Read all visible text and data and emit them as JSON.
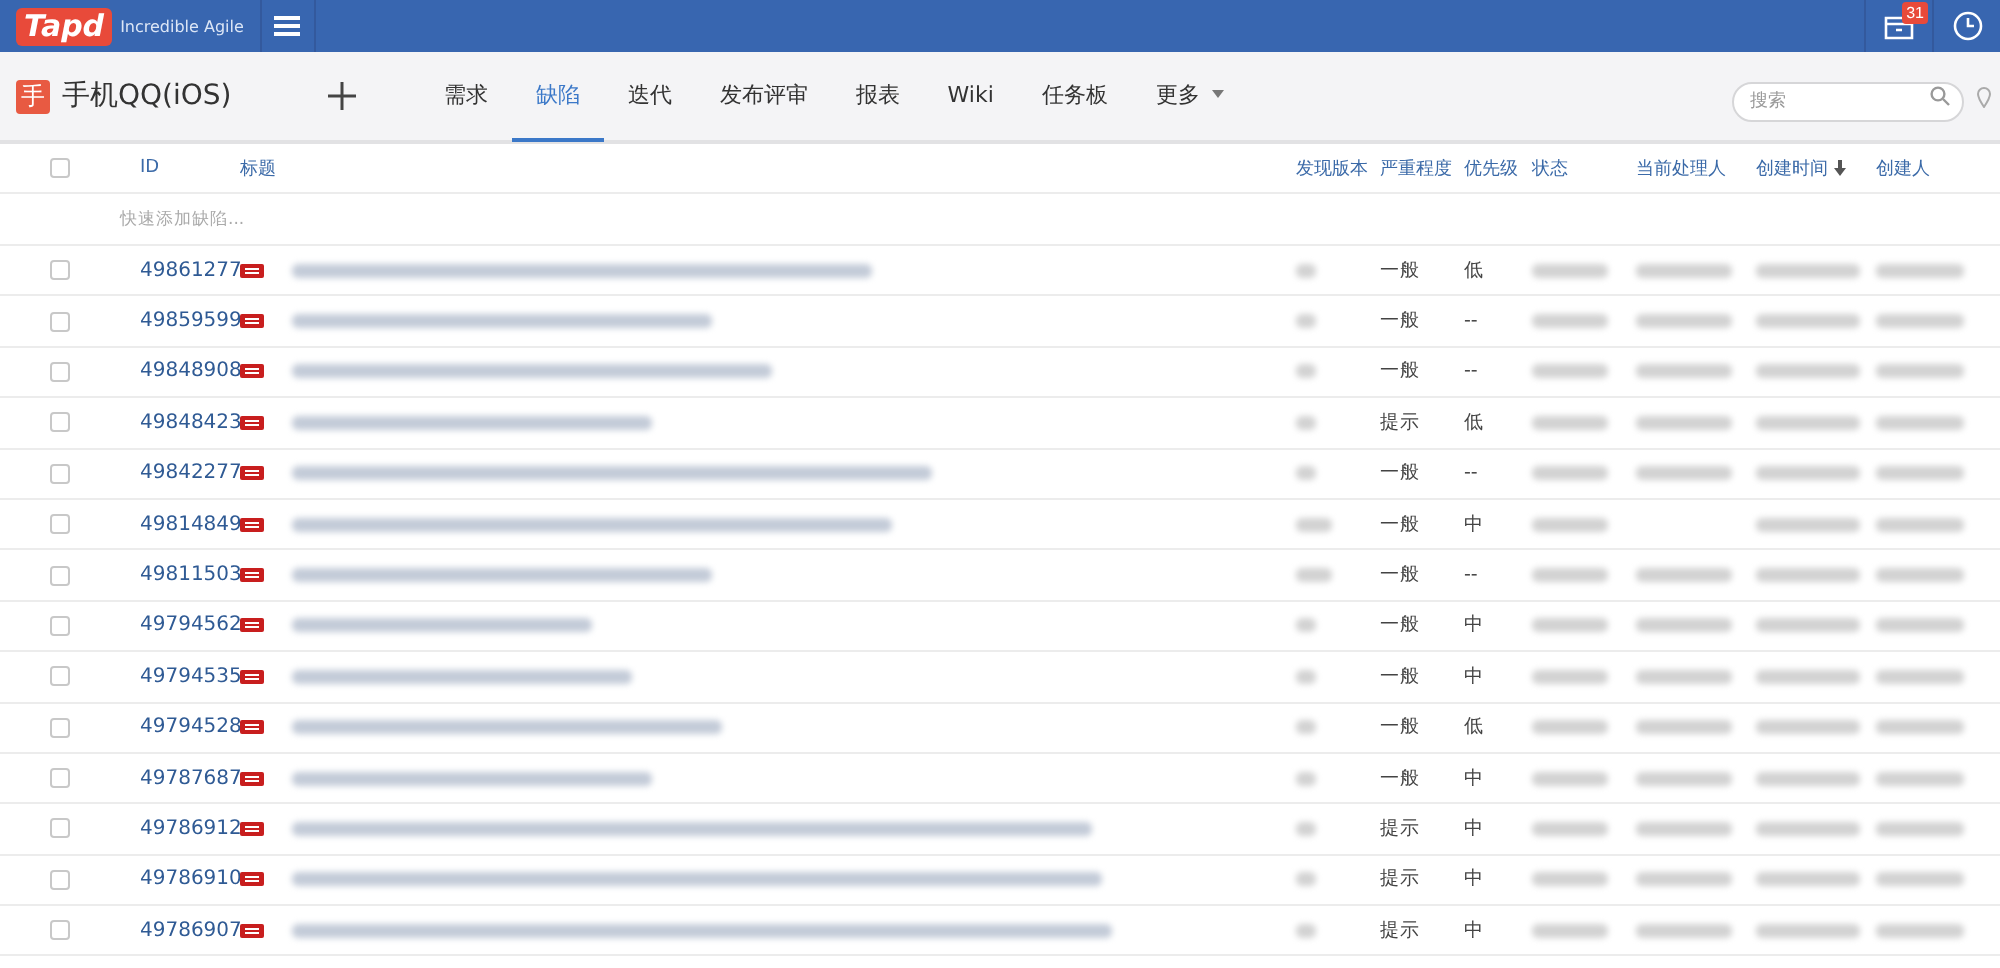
{
  "topbar": {
    "logo": "Tapd",
    "tagline": "Incredible Agile",
    "notification_count": "31"
  },
  "project": {
    "icon_char": "手",
    "name": "手机QQ(iOS)"
  },
  "tabs": [
    {
      "label": "需求",
      "selected": false
    },
    {
      "label": "缺陷",
      "selected": true
    },
    {
      "label": "迭代",
      "selected": false
    },
    {
      "label": "发布评审",
      "selected": false
    },
    {
      "label": "报表",
      "selected": false
    },
    {
      "label": "Wiki",
      "selected": false
    },
    {
      "label": "任务板",
      "selected": false
    },
    {
      "label": "更多",
      "selected": false,
      "dropdown": true
    }
  ],
  "search": {
    "placeholder": "搜索"
  },
  "table": {
    "columns": [
      {
        "label": "ID",
        "sorted": false
      },
      {
        "label": "标题",
        "sorted": false
      },
      {
        "label": "发现版本",
        "sorted": false
      },
      {
        "label": "严重程度",
        "sorted": false
      },
      {
        "label": "优先级",
        "sorted": false
      },
      {
        "label": "状态",
        "sorted": false
      },
      {
        "label": "当前处理人",
        "sorted": false
      },
      {
        "label": "创建时间",
        "sorted": true
      },
      {
        "label": "创建人",
        "sorted": false
      }
    ],
    "all_checked": false,
    "quick_add_placeholder": "快速添加缺陷...",
    "rows": [
      {
        "id": "49861277",
        "checked": false,
        "severity": "一般",
        "priority": "低",
        "has_handler": true
      },
      {
        "id": "49859599",
        "checked": false,
        "severity": "一般",
        "priority": "--",
        "has_handler": true
      },
      {
        "id": "49848908",
        "checked": false,
        "severity": "一般",
        "priority": "--",
        "has_handler": true
      },
      {
        "id": "49848423",
        "checked": false,
        "severity": "提示",
        "priority": "低",
        "has_handler": true
      },
      {
        "id": "49842277",
        "checked": false,
        "severity": "一般",
        "priority": "--",
        "has_handler": true
      },
      {
        "id": "49814849",
        "checked": false,
        "severity": "一般",
        "priority": "中",
        "has_handler": false
      },
      {
        "id": "49811503",
        "checked": false,
        "severity": "一般",
        "priority": "--",
        "has_handler": true
      },
      {
        "id": "49794562",
        "checked": false,
        "severity": "一般",
        "priority": "中",
        "has_handler": true
      },
      {
        "id": "49794535",
        "checked": false,
        "severity": "一般",
        "priority": "中",
        "has_handler": true
      },
      {
        "id": "49794528",
        "checked": false,
        "severity": "一般",
        "priority": "低",
        "has_handler": true
      },
      {
        "id": "49787687",
        "checked": false,
        "severity": "一般",
        "priority": "中",
        "has_handler": true
      },
      {
        "id": "49786912",
        "checked": false,
        "severity": "提示",
        "priority": "中",
        "has_handler": true
      },
      {
        "id": "49786910",
        "checked": false,
        "severity": "提示",
        "priority": "中",
        "has_handler": true
      },
      {
        "id": "49786907",
        "checked": false,
        "severity": "提示",
        "priority": "中",
        "has_handler": true
      }
    ]
  }
}
